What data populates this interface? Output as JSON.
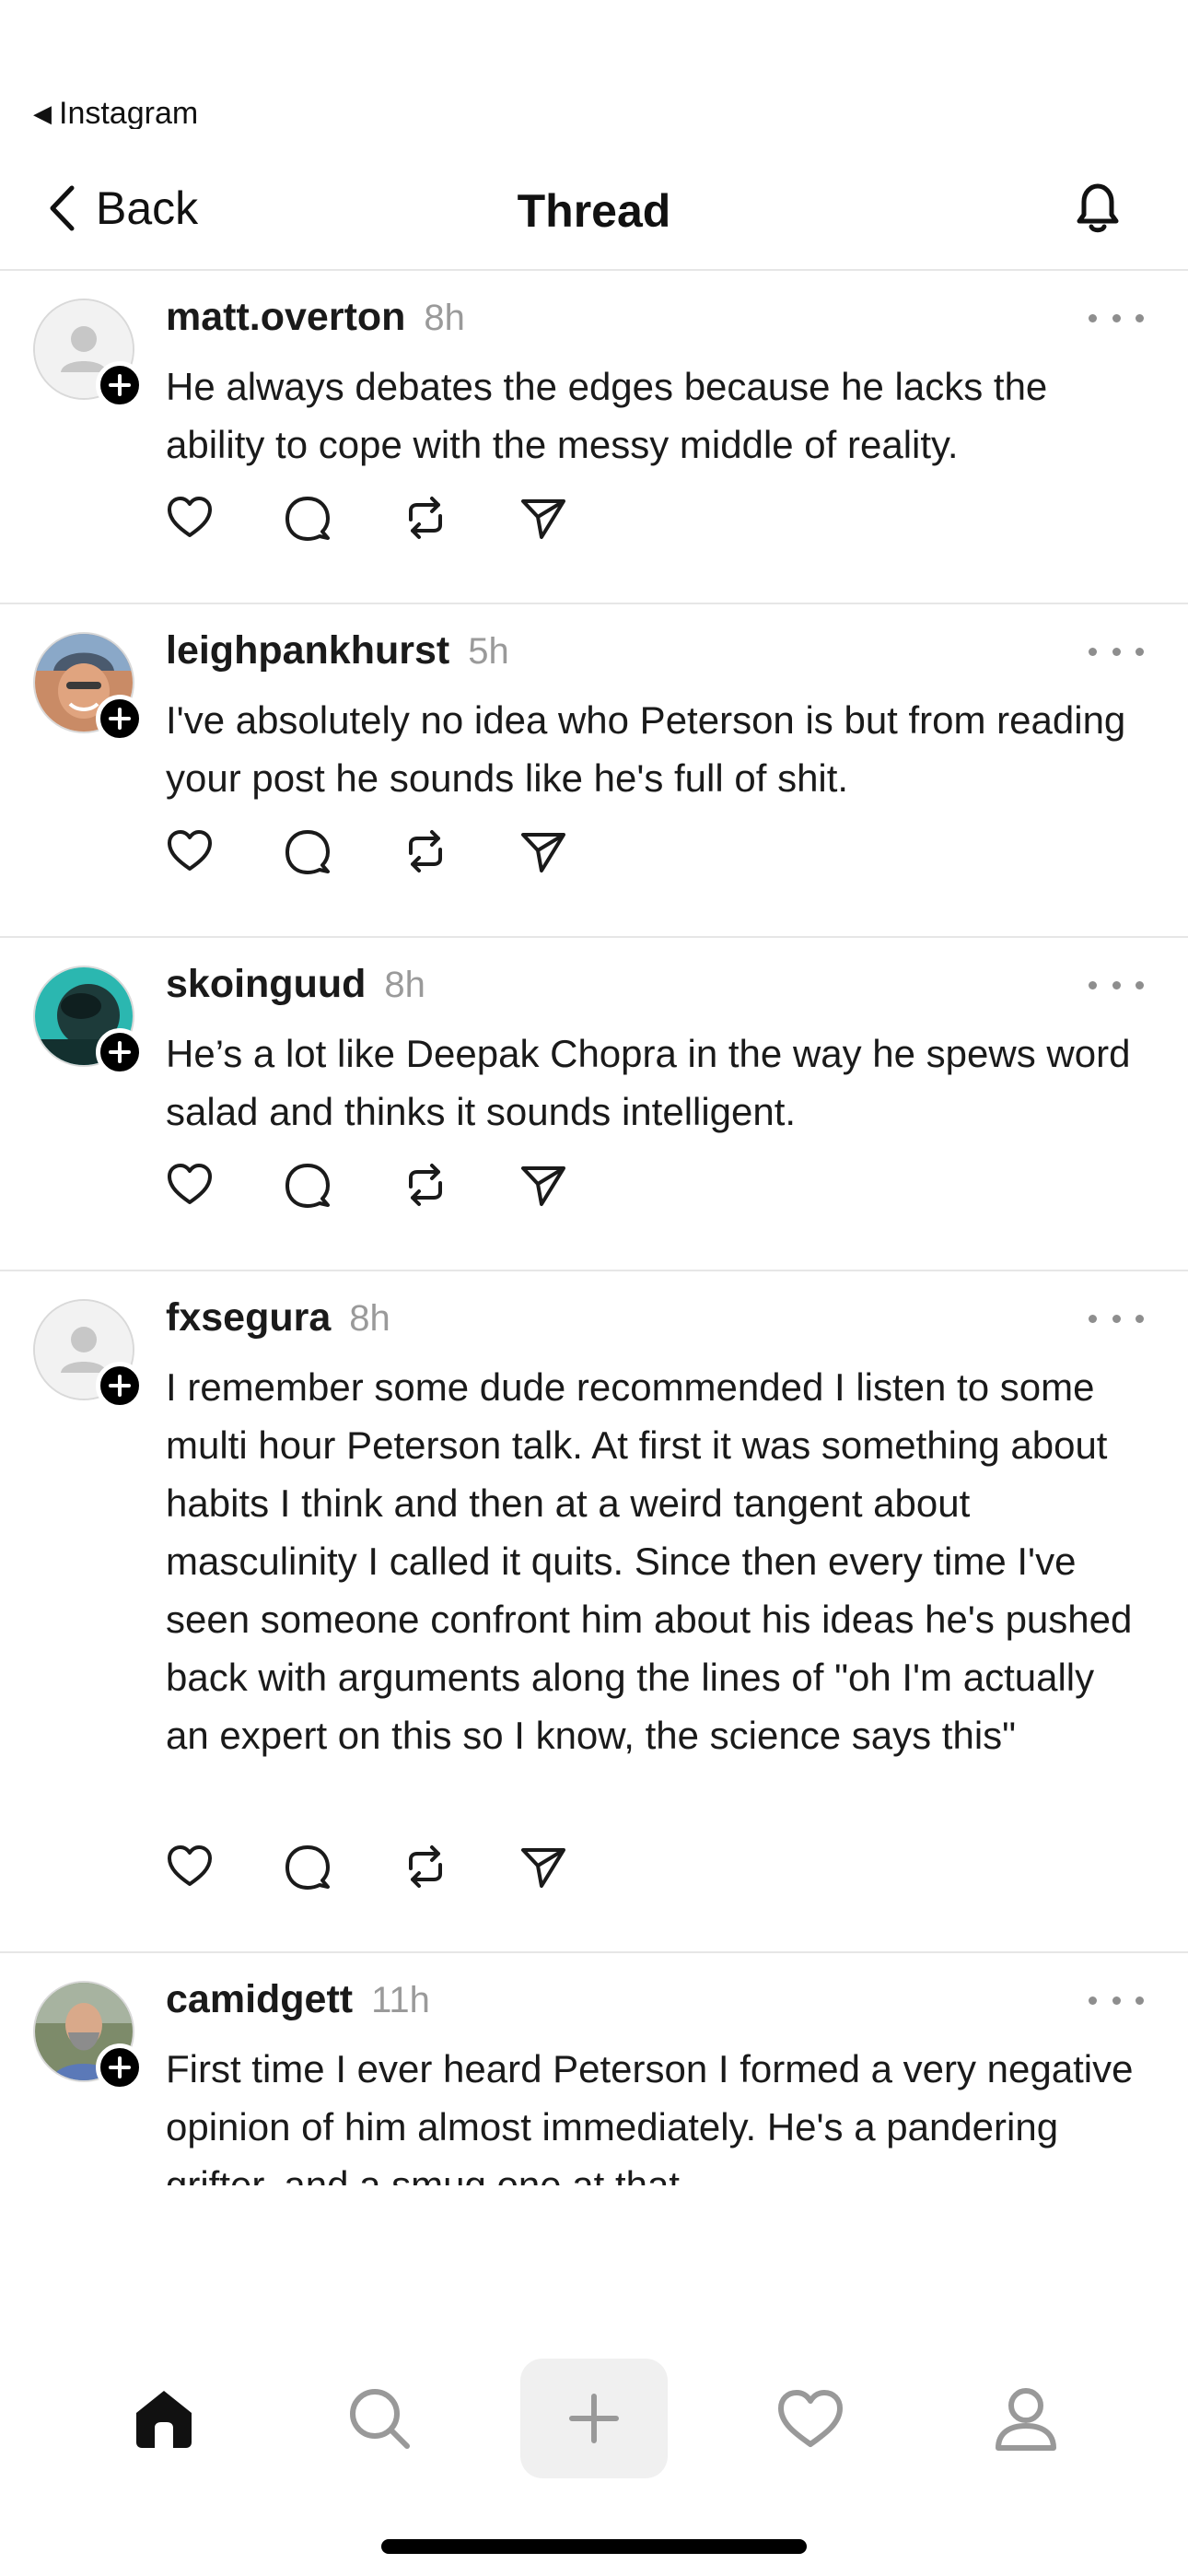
{
  "status": {
    "back_to_app_label": "Instagram"
  },
  "header": {
    "back_label": "Back",
    "title": "Thread"
  },
  "posts": [
    {
      "username": "matt.overton",
      "time": "8h",
      "text": "He always debates the edges because he lacks the ability to cope with the messy middle of reality.",
      "avatar": "default-avatar-icon"
    },
    {
      "username": "leighpankhurst",
      "time": "5h",
      "text": "I've absolutely no idea who Peterson is but from reading your post he sounds like he's full of shit.",
      "avatar": "user-photo"
    },
    {
      "username": "skoinguud",
      "time": "8h",
      "text": "He’s a lot like Deepak Chopra in the way he spews word salad and thinks it sounds intelligent.",
      "avatar": "user-photo"
    },
    {
      "username": "fxsegura",
      "time": "8h",
      "text": "I remember some dude recommended I listen to some multi hour Peterson talk. At first it was something about habits I think and then at a weird tangent about masculinity I called it quits. Since then every time I've seen someone confront him about his ideas he's pushed back with arguments along the lines of \"oh I'm actually an expert on this so I know, the science says this\"",
      "avatar": "default-avatar-icon"
    },
    {
      "username": "camidgett",
      "time": "11h",
      "text": "First time I ever heard Peterson I formed a very negative opinion of him almost immediately. He's a pandering grifter, and a smug one at that.",
      "avatar": "user-photo"
    }
  ],
  "actions": [
    "heart-icon",
    "comment-icon",
    "repost-icon",
    "share-icon"
  ],
  "bottom_nav": [
    "home-icon",
    "search-icon",
    "compose-plus-icon",
    "activity-heart-icon",
    "profile-icon"
  ],
  "colors": {
    "text": "#111111",
    "muted": "#9a9a9a",
    "divider": "#e6e6e6",
    "icon": "#1a1a1a",
    "nav_inactive": "#999999"
  }
}
